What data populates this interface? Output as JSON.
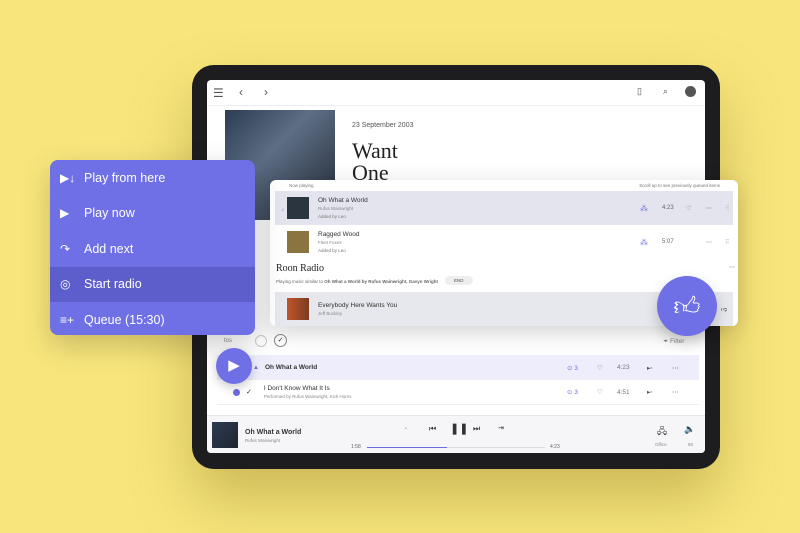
{
  "colors": {
    "background": "#f8e67c",
    "accent": "#6f6fe6",
    "menu_selected": "#5d5dcc"
  },
  "header": {
    "icons": [
      "menu-icon",
      "back-icon",
      "forward-icon",
      "bookmark-icon",
      "search-icon",
      "avatar"
    ]
  },
  "album": {
    "date": "23 September 2003",
    "title": "Want One"
  },
  "context_menu": {
    "items": [
      {
        "icon": "play-from-here-icon",
        "label": "Play from here"
      },
      {
        "icon": "play-icon",
        "label": "Play now"
      },
      {
        "icon": "add-next-icon",
        "label": "Add next"
      },
      {
        "icon": "radio-icon",
        "label": "Start radio",
        "selected": true
      },
      {
        "icon": "queue-icon",
        "label": "Queue (15:30)"
      }
    ]
  },
  "queue": {
    "now_playing_label": "Now playing",
    "scroll_hint": "Scroll up to see previously queued items",
    "items": [
      {
        "title": "Oh What a World",
        "artist": "Rufus Wainwright",
        "added_by": "Added by Leo",
        "duration": "4:23"
      },
      {
        "title": "Ragged Wood",
        "artist": "Fleet Foxes",
        "added_by": "Added by Leo",
        "duration": "5:07"
      }
    ],
    "radio": {
      "title": "Roon Radio",
      "desc_prefix": "Playing music similar to",
      "desc_bold": "Oh What a World by Rufus Wainwright, Gavyn Wright",
      "end_label": "END",
      "item": {
        "title": "Everybody Here Wants You",
        "artist": "Jeff Buckley"
      }
    }
  },
  "tracks_toolbar": {
    "filter_label": "Filter",
    "partial": "tos"
  },
  "tracks": [
    {
      "title": "Oh What a World",
      "credit": "",
      "count": "3",
      "duration": "4:23"
    },
    {
      "title": "I Don't Know What It Is",
      "credit": "Performed by Rufus Wainwright, Kick Horns",
      "count": "3",
      "duration": "4:51"
    }
  ],
  "player": {
    "title": "Oh What a World",
    "artist": "Rufus Wainwright",
    "elapsed": "1:58",
    "total": "4:23",
    "progress": 0.45,
    "zone": "Office",
    "volume": "50"
  }
}
